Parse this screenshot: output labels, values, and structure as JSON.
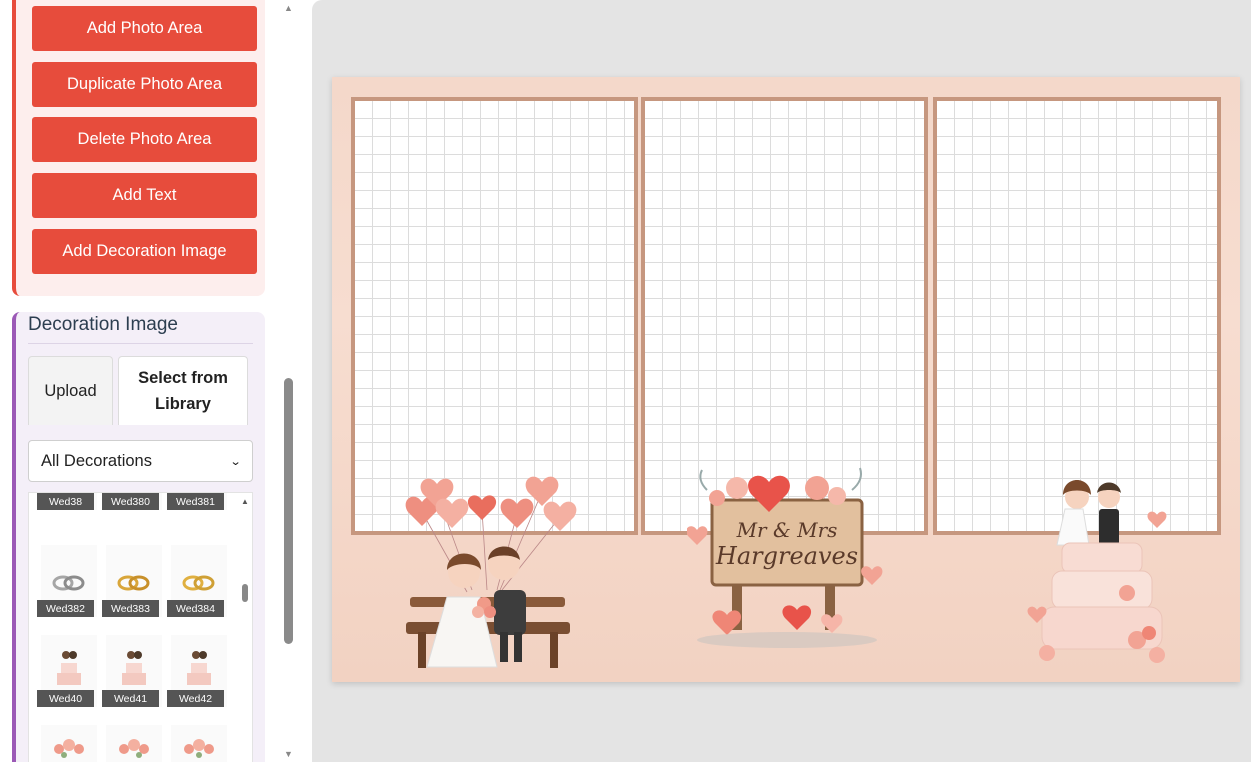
{
  "actions": {
    "add_photo_area": "Add Photo Area",
    "duplicate_photo_area": "Duplicate Photo Area",
    "delete_photo_area": "Delete Photo Area",
    "add_text": "Add Text",
    "add_decoration_image": "Add Decoration Image"
  },
  "decoration_panel": {
    "title": "Decoration Image",
    "tabs": {
      "upload": "Upload",
      "library": "Select from Library"
    },
    "category_select": {
      "selected": "All Decorations"
    },
    "items": [
      {
        "label": "Wed38",
        "icon": "wedding-photo-icon"
      },
      {
        "label": "Wed380",
        "icon": "wedding-couple-icon"
      },
      {
        "label": "Wed381",
        "icon": "gold-rings-icon"
      },
      {
        "label": "Wed382",
        "icon": "silver-rings-icon"
      },
      {
        "label": "Wed383",
        "icon": "gold-rings-icon"
      },
      {
        "label": "Wed384",
        "icon": "gold-rings-icon"
      },
      {
        "label": "Wed40",
        "icon": "wedding-cake-icon"
      },
      {
        "label": "Wed41",
        "icon": "wedding-cake-icon"
      },
      {
        "label": "Wed42",
        "icon": "wedding-cake-icon"
      },
      {
        "label": "",
        "icon": "flower-bouquet-icon"
      },
      {
        "label": "",
        "icon": "flower-bouquet-icon"
      },
      {
        "label": "",
        "icon": "flower-bouquet-icon"
      }
    ]
  },
  "canvas": {
    "sign": {
      "line1": "Mr & Mrs",
      "line2": "Hargreaves"
    },
    "decorations": [
      "couple-on-bench-with-balloons",
      "mr-mrs-wooden-sign",
      "wedding-cake-topper-couple"
    ],
    "colors": {
      "background": "#f4d8ca",
      "frame": "#c6977f",
      "accent": "#e74c3c",
      "secondary": "#9b59b6"
    }
  }
}
